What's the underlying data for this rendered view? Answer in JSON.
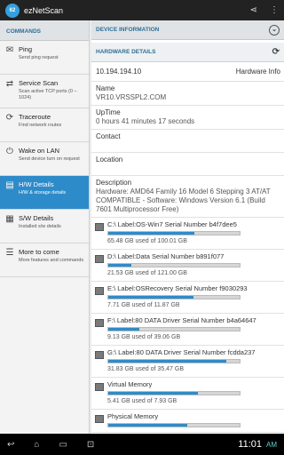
{
  "app": {
    "name": "ezNetScan",
    "logo_text": "62"
  },
  "sidebar": {
    "header": "COMMANDS",
    "items": [
      {
        "label": "Ping",
        "desc": "Send ping request",
        "icon": "ping-icon",
        "glyph": "✉",
        "active": false
      },
      {
        "label": "Service Scan",
        "desc": "Scan active TCP ports (0 – 1024)",
        "icon": "service-scan-icon",
        "glyph": "⇄",
        "active": false
      },
      {
        "label": "Traceroute",
        "desc": "Find network routes",
        "icon": "traceroute-icon",
        "glyph": "⟳",
        "active": false
      },
      {
        "label": "Wake on LAN",
        "desc": "Send device turn on request",
        "icon": "power-icon",
        "glyph": "⏻",
        "active": false
      },
      {
        "label": "H/W Details",
        "desc": "H/W & storage details",
        "icon": "hardware-icon",
        "glyph": "▤",
        "active": true
      },
      {
        "label": "S/W Details",
        "desc": "Installed s/w details",
        "icon": "software-icon",
        "glyph": "▦",
        "active": false
      },
      {
        "label": "More to come",
        "desc": "More features and commands",
        "icon": "more-icon",
        "glyph": "☰",
        "active": false
      }
    ]
  },
  "main": {
    "device_header": "DEVICE INFORMATION",
    "hw_header": "HARDWARE DETAILS",
    "ip": "10.194.194.10",
    "ip_label": "Hardware Info",
    "name_label": "Name",
    "name": "VR10.VRSSPL2.COM",
    "uptime_label": "UpTime",
    "uptime": "0 hours 41 minutes 17 seconds",
    "contact_label": "Contact",
    "contact": "",
    "location_label": "Location",
    "location": "",
    "description_label": "Description",
    "description": "Hardware: AMD64 Family 16 Model 6 Stepping 3 AT/AT COMPATIBLE - Software: Windows Version 6.1 (Build 7601 Multiprocessor Free)",
    "drives": [
      {
        "title": "C:\\ Label:OS-Win7  Serial Number b4f7dee5",
        "usage": "65.48 GB used of 100.01 GB",
        "fill": 0.655
      },
      {
        "title": "D:\\ Label:Data  Serial Number b891f077",
        "usage": "21.53 GB used of 121.00 GB",
        "fill": 0.178
      },
      {
        "title": "E:\\ Label:OSRecovery  Serial Number f9030293",
        "usage": "7.71 GB used of 11.87 GB",
        "fill": 0.65
      },
      {
        "title": "F:\\ Label:80 DATA Driver  Serial Number b4a64647",
        "usage": "9.13 GB used of 39.06 GB",
        "fill": 0.234
      },
      {
        "title": "G:\\ Label:80 DATA Driver  Serial Number fcdda237",
        "usage": "31.83 GB used of 35.47 GB",
        "fill": 0.897
      },
      {
        "title": "Virtual Memory",
        "usage": "5.41 GB used of 7.93 GB",
        "fill": 0.682
      },
      {
        "title": "Physical Memory",
        "usage": "",
        "fill": 0.6
      }
    ]
  },
  "system": {
    "time": "11:01",
    "ampm": "AM"
  }
}
